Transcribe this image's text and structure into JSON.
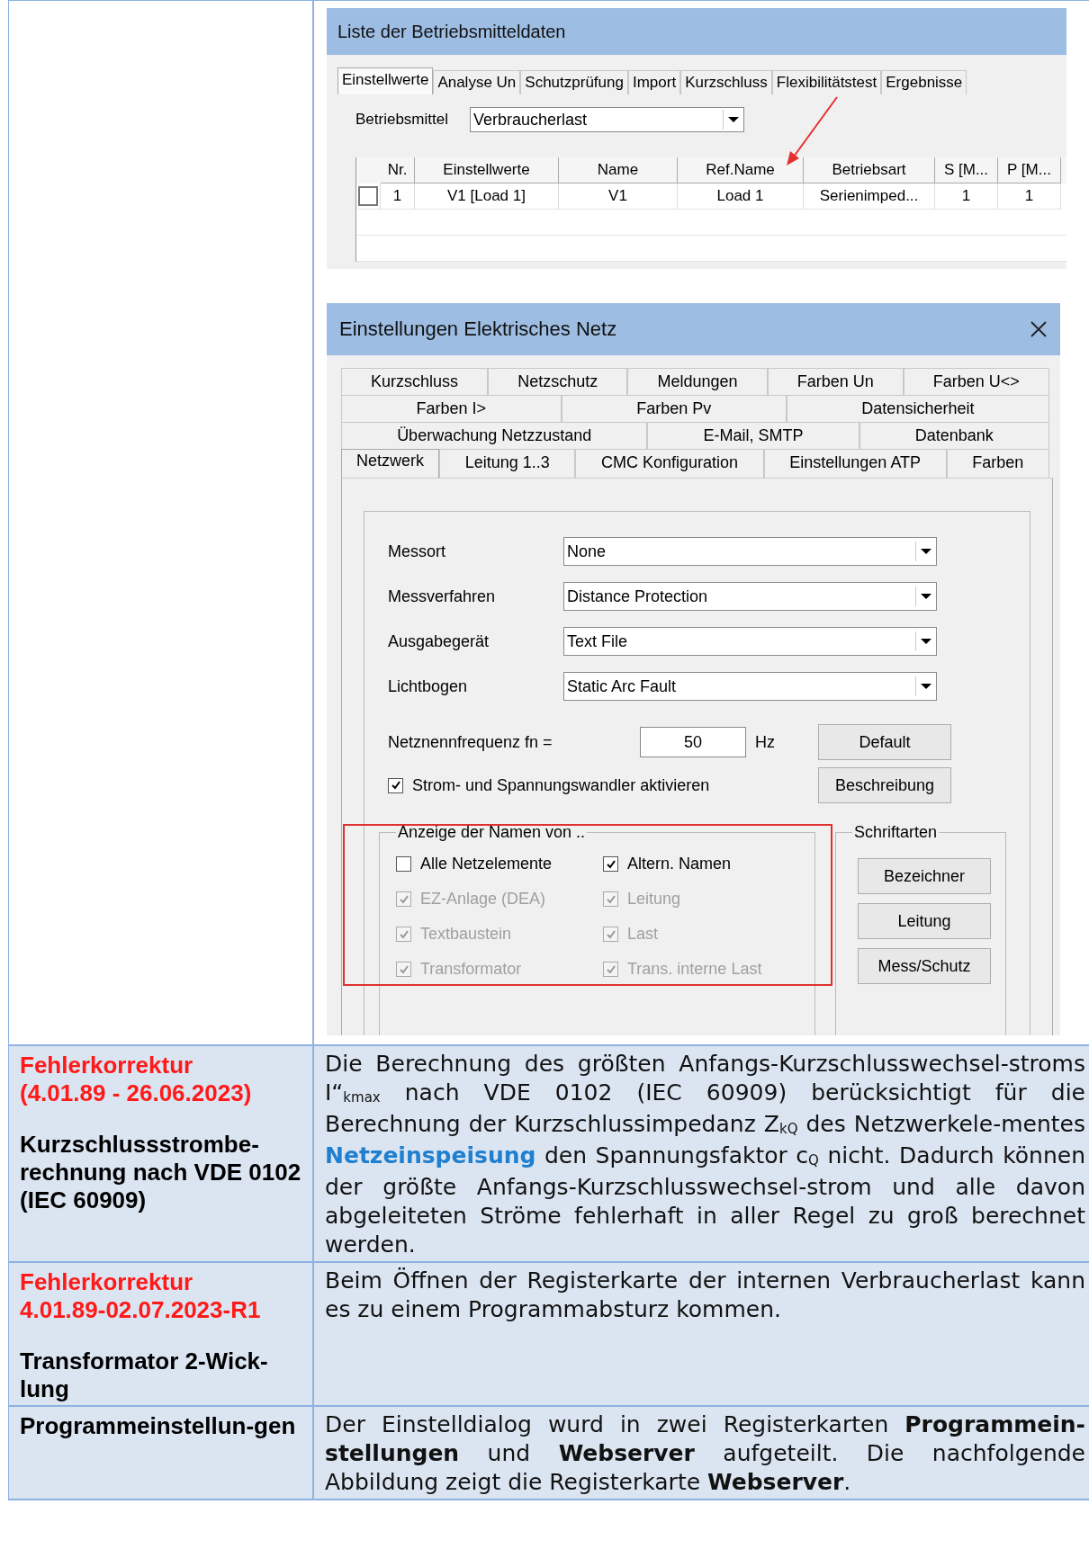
{
  "list_window": {
    "title": "Liste der Betriebsmitteldaten",
    "tabs": [
      {
        "label": "Einstellwerte",
        "selected": true
      },
      {
        "label": "Analyse Un",
        "selected": false
      },
      {
        "label": "Schutzprüfung",
        "selected": false
      },
      {
        "label": "Import",
        "selected": false
      },
      {
        "label": "Kurzschluss",
        "selected": false
      },
      {
        "label": "Flexibilitätstest",
        "selected": false
      },
      {
        "label": "Ergebnisse",
        "selected": false
      }
    ],
    "field": {
      "label": "Betriebsmittel",
      "value": "Verbraucherlast"
    },
    "grid": {
      "columns": [
        "Nr.",
        "Einstellwerte",
        "Name",
        "Ref.Name",
        "Betriebsart",
        "S [M...",
        "P [M..."
      ],
      "rows": [
        {
          "checked": false,
          "cells": [
            "1",
            "V1 [Load 1]",
            "V1",
            "Load 1",
            "Serienimped...",
            "1",
            "1"
          ]
        }
      ]
    }
  },
  "settings_dialog": {
    "title": "Einstellungen Elektrisches Netz",
    "tab_rows": [
      [
        {
          "label": "Kurzschluss",
          "selected": false
        },
        {
          "label": "Netzschutz",
          "selected": false
        },
        {
          "label": "Meldungen",
          "selected": false
        },
        {
          "label": "Farben Un",
          "selected": false
        },
        {
          "label": "Farben U<>",
          "selected": false
        }
      ],
      [
        {
          "label": "Farben I>",
          "selected": false
        },
        {
          "label": "Farben Pv",
          "selected": false
        },
        {
          "label": "Datensicherheit",
          "selected": false
        }
      ],
      [
        {
          "label": "Überwachung Netzzustand",
          "selected": false
        },
        {
          "label": "E-Mail, SMTP",
          "selected": false
        },
        {
          "label": "Datenbank",
          "selected": false
        }
      ],
      [
        {
          "label": "Netzwerk",
          "selected": true
        },
        {
          "label": "Leitung 1..3",
          "selected": false
        },
        {
          "label": "CMC Konfiguration",
          "selected": false
        },
        {
          "label": "Einstellungen ATP",
          "selected": false
        },
        {
          "label": "Farben",
          "selected": false
        }
      ]
    ],
    "dropdowns": [
      {
        "label": "Messort",
        "value": "None"
      },
      {
        "label": "Messverfahren",
        "value": "Distance Protection"
      },
      {
        "label": "Ausgabegerät",
        "value": "Text File"
      },
      {
        "label": "Lichtbogen",
        "value": "Static Arc Fault"
      }
    ],
    "frequency": {
      "label": "Netznennfrequenz fn =",
      "value": "50",
      "unit": "Hz"
    },
    "converter": {
      "label": "Strom- und Spannungswandler aktivieren",
      "checked": true
    },
    "buttons": [
      "Default",
      "Beschreibung"
    ],
    "names_group": {
      "title": "Anzeige der Namen von ..",
      "options": [
        {
          "label": "Alle Netzelemente",
          "checked": false,
          "disabled": false
        },
        {
          "label": "Altern. Namen",
          "checked": true,
          "disabled": false
        },
        {
          "label": "EZ-Anlage (DEA)",
          "checked": true,
          "disabled": true
        },
        {
          "label": "Leitung",
          "checked": true,
          "disabled": true
        },
        {
          "label": "Textbaustein",
          "checked": true,
          "disabled": true
        },
        {
          "label": "Last",
          "checked": true,
          "disabled": true
        },
        {
          "label": "Transformator",
          "checked": true,
          "disabled": true
        },
        {
          "label": "Trans. interne Last",
          "checked": true,
          "disabled": true
        }
      ]
    },
    "fonts_group": {
      "title": "Schriftarten",
      "buttons": [
        "Bezeichner",
        "Leitung",
        "Mess/Schutz"
      ]
    }
  },
  "notes": [
    {
      "release": [
        "Fehlerkorrektur",
        "(4.01.89 - 26.06.2023)"
      ],
      "subject": "Kurzschlussstrombe-rechnung nach VDE 0102 (IEC 60909)",
      "parts": [
        {
          "kind": "text",
          "text": "Die Berechnung des größten Anfangs-Kurzschlusswechsel-stroms I“$_{kmax}$ nach VDE 0102 (IEC 60909) berücksichtigt für die Berechnung der Kurzschlussimpedanz Z$_{kQ}$ des Netzwerkele-mentes "
        },
        {
          "kind": "term",
          "text": "Netzeinspeisung"
        },
        {
          "kind": "text",
          "text": " den Spannungsfaktor c$_{Q}$ nicht. Dadurch können der größte Anfangs-Kurzschlusswechsel-strom und alle davon abgeleiteten Ströme fehlerhaft in aller Regel zu groß berechnet werden."
        }
      ]
    },
    {
      "release": [
        "Fehlerkorrektur",
        "4.01.89-02.07.2023-R1"
      ],
      "subject": "Transformator 2-Wick-lung",
      "parts": [
        {
          "kind": "text",
          "text": "Beim Öffnen der Registerkarte der internen Verbraucherlast kann es zu einem Programmabsturz kommen."
        }
      ]
    },
    {
      "subject": "Programmeinstellun-gen",
      "parts": [
        {
          "kind": "text",
          "text": "Der Einstelldialog wurd in zwei Registerkarten **Programmein-stellungen** und **Webserver** aufgeteilt. Die nachfolgende Abbildung zeigt die Registerkarte **Webserver**."
        }
      ]
    }
  ]
}
